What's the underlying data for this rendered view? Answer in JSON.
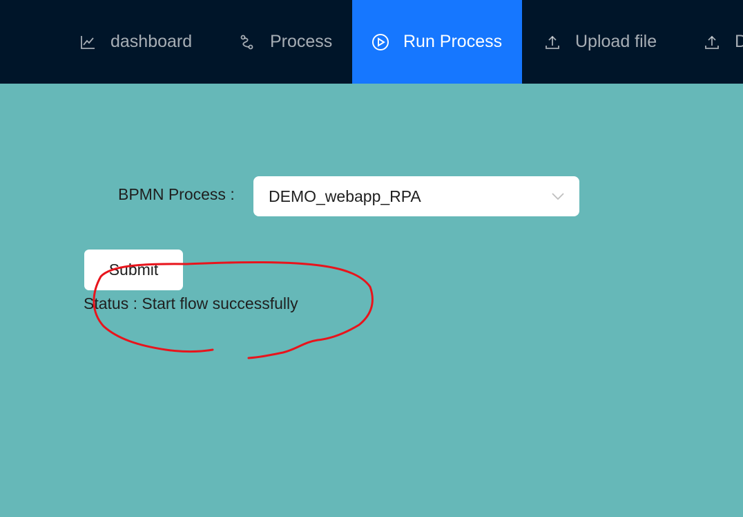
{
  "nav": {
    "items": [
      {
        "label": "dashboard",
        "icon": "line-chart-icon",
        "active": false
      },
      {
        "label": "Process",
        "icon": "branches-icon",
        "active": false
      },
      {
        "label": "Run Process",
        "icon": "play-circle-icon",
        "active": true
      },
      {
        "label": "Upload file",
        "icon": "upload-icon",
        "active": false
      },
      {
        "label": "D",
        "icon": "upload-icon",
        "active": false
      }
    ]
  },
  "form": {
    "process_label": "BPMN Process :",
    "process_value": "DEMO_webapp_RPA",
    "submit_label": "Submit",
    "status_text": "Status : Start flow successfully"
  },
  "colors": {
    "nav_bg": "#001529",
    "active_bg": "#1677ff",
    "page_bg": "#66b8b8",
    "annotation": "#e8141c"
  }
}
